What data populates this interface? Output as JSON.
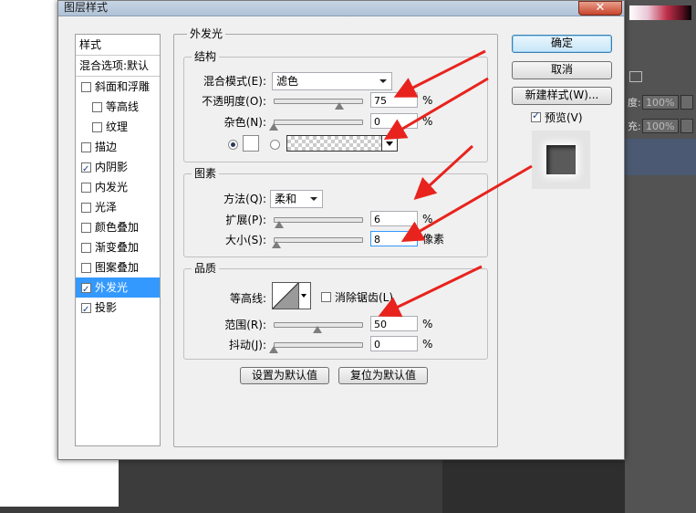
{
  "dialog": {
    "title": "图层样式",
    "close_label": "✕"
  },
  "style_list": {
    "header": "样式",
    "blend_options": "混合选项:默认",
    "items": [
      {
        "label": "斜面和浮雕",
        "checked": false,
        "sub": false
      },
      {
        "label": "等高线",
        "checked": false,
        "sub": true
      },
      {
        "label": "纹理",
        "checked": false,
        "sub": true
      },
      {
        "label": "描边",
        "checked": false,
        "sub": false
      },
      {
        "label": "内阴影",
        "checked": true,
        "sub": false
      },
      {
        "label": "内发光",
        "checked": false,
        "sub": false
      },
      {
        "label": "光泽",
        "checked": false,
        "sub": false
      },
      {
        "label": "颜色叠加",
        "checked": false,
        "sub": false
      },
      {
        "label": "渐变叠加",
        "checked": false,
        "sub": false
      },
      {
        "label": "图案叠加",
        "checked": false,
        "sub": false
      },
      {
        "label": "外发光",
        "checked": true,
        "sub": false,
        "selected": true
      },
      {
        "label": "投影",
        "checked": true,
        "sub": false
      }
    ]
  },
  "panel": {
    "title": "外发光",
    "structure": {
      "title": "结构",
      "blend_mode_label": "混合模式(E):",
      "blend_mode_value": "滤色",
      "opacity_label": "不透明度(O):",
      "opacity_value": "75",
      "opacity_unit": "%",
      "opacity_level": 0.75,
      "noise_label": "杂色(N):",
      "noise_value": "0",
      "noise_unit": "%",
      "noise_level": 0
    },
    "elements": {
      "title": "图素",
      "technique_label": "方法(Q):",
      "technique_value": "柔和",
      "spread_label": "扩展(P):",
      "spread_value": "6",
      "spread_unit": "%",
      "spread_level": 0.06,
      "size_label": "大小(S):",
      "size_value": "8",
      "size_unit": "像素",
      "size_level": 0.03
    },
    "quality": {
      "title": "品质",
      "contour_label": "等高线:",
      "antialias_label": "消除锯齿(L)",
      "antialias_checked": false,
      "range_label": "范围(R):",
      "range_value": "50",
      "range_unit": "%",
      "range_level": 0.5,
      "jitter_label": "抖动(J):",
      "jitter_value": "0",
      "jitter_unit": "%",
      "jitter_level": 0
    },
    "make_default": "设置为默认值",
    "reset_default": "复位为默认值"
  },
  "buttons": {
    "ok": "确定",
    "cancel": "取消",
    "new_style": "新建样式(W)...",
    "preview_label": "预览(V)",
    "preview_checked": true
  },
  "background_panel": {
    "fields": [
      "100%",
      "100%"
    ],
    "labels": [
      "度:",
      "充:"
    ]
  },
  "colors": {
    "arrow": "#e8231d",
    "selection": "#3399ff",
    "glow_swatch": "#ffffff"
  }
}
